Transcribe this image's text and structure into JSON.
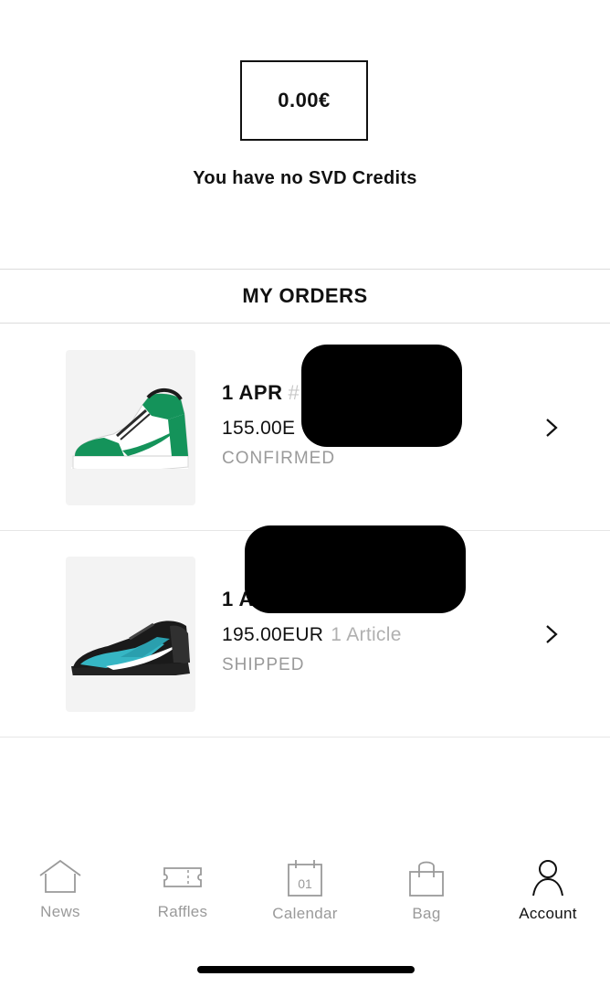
{
  "credits": {
    "amount": "0.00€",
    "message": "You have no SVD Credits"
  },
  "orders_section": {
    "title": "MY ORDERS",
    "orders": [
      {
        "date": "1 APR",
        "number_fragment": "#",
        "price": "155.00E",
        "articles": "",
        "status": "CONFIRMED",
        "shoe_colors": {
          "primary": "#14935a",
          "secondary": "#ffffff",
          "sole": "#ffffff"
        }
      },
      {
        "date": "1 AP",
        "number_fragment": "",
        "price": "195.00EUR",
        "articles": "1 Article",
        "status": "SHIPPED",
        "shoe_colors": {
          "primary": "#1a1a1a",
          "secondary": "#36b6c4",
          "sole": "#2a2a2a"
        }
      }
    ]
  },
  "tabbar": {
    "tabs": [
      {
        "label": "News",
        "icon": "house-icon",
        "active": false
      },
      {
        "label": "Raffles",
        "icon": "ticket-icon",
        "active": false
      },
      {
        "label": "Calendar",
        "icon": "calendar-icon",
        "active": false,
        "icon_text": "01"
      },
      {
        "label": "Bag",
        "icon": "shopping-bag-icon",
        "active": false
      },
      {
        "label": "Account",
        "icon": "user-icon",
        "active": true
      }
    ]
  }
}
